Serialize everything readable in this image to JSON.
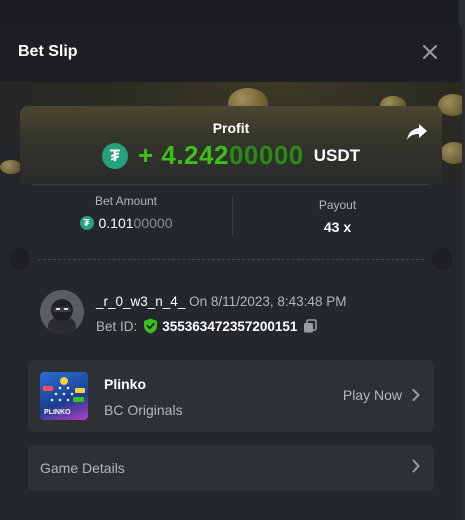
{
  "modal": {
    "title": "Bet Slip"
  },
  "profit": {
    "label": "Profit",
    "sign": "+ ",
    "amount_bright": "4.242",
    "amount_dim": "00000",
    "currency": "USDT",
    "currency_icon": "tether-icon",
    "color": "#3bc117"
  },
  "bet": {
    "amount_label": "Bet Amount",
    "amount_bright": "0.101",
    "amount_dim": "00000",
    "payout_label": "Payout",
    "payout_value": "43 x"
  },
  "user": {
    "name": "_r_0_w3_n_4_",
    "date": "On 8/11/2023, 8:43:48 PM",
    "bet_id_label": "Bet ID:",
    "bet_id": "355363472357200151"
  },
  "game": {
    "name": "Plinko",
    "provider": "BC Originals",
    "play_label": "Play Now",
    "thumb_label": "PLINKO"
  },
  "details": {
    "label": "Game Details"
  }
}
